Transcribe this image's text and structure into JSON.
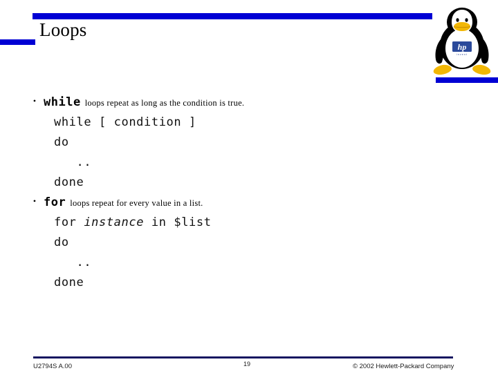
{
  "slide": {
    "title": "Loops",
    "bullets": [
      {
        "keyword": "while",
        "description": "loops repeat as long as the condition is true.",
        "code": [
          {
            "pre": "while [ condition ]",
            "italic": "",
            "post": ""
          },
          {
            "pre": "do",
            "italic": "",
            "post": ""
          },
          {
            "pre": "   ..",
            "italic": "",
            "post": ""
          },
          {
            "pre": "done",
            "italic": "",
            "post": ""
          }
        ]
      },
      {
        "keyword": "for",
        "description": "loops repeat for every value in a list.",
        "code": [
          {
            "pre": "for ",
            "italic": "instance",
            "post": " in $list"
          },
          {
            "pre": "do",
            "italic": "",
            "post": ""
          },
          {
            "pre": "   ..",
            "italic": "",
            "post": ""
          },
          {
            "pre": "done",
            "italic": "",
            "post": ""
          }
        ]
      }
    ]
  },
  "code_lines": {
    "while_1": "while [ condition ]",
    "while_2": "do",
    "while_3": "   ..",
    "while_4": "done",
    "for_1_pre": "for ",
    "for_1_italic": "instance",
    "for_1_post": " in $list",
    "for_2": "do",
    "for_3": "   ..",
    "for_4": "done"
  },
  "bullet_glyph": "•",
  "footer": {
    "document_id": "U2794S A.00",
    "page_number": "19",
    "copyright": "© 2002 Hewlett-Packard Company"
  },
  "logo": {
    "name": "tux-penguin-with-hp-logo",
    "brand_text": "hp",
    "brand_tagline": "invent"
  },
  "colors": {
    "accent_blue": "#0000d4",
    "footer_rule": "#151560",
    "hp_blue": "#2b4a9b",
    "tux_body": "#000000",
    "tux_belly": "#ffffff",
    "tux_feet": "#f2b705"
  }
}
